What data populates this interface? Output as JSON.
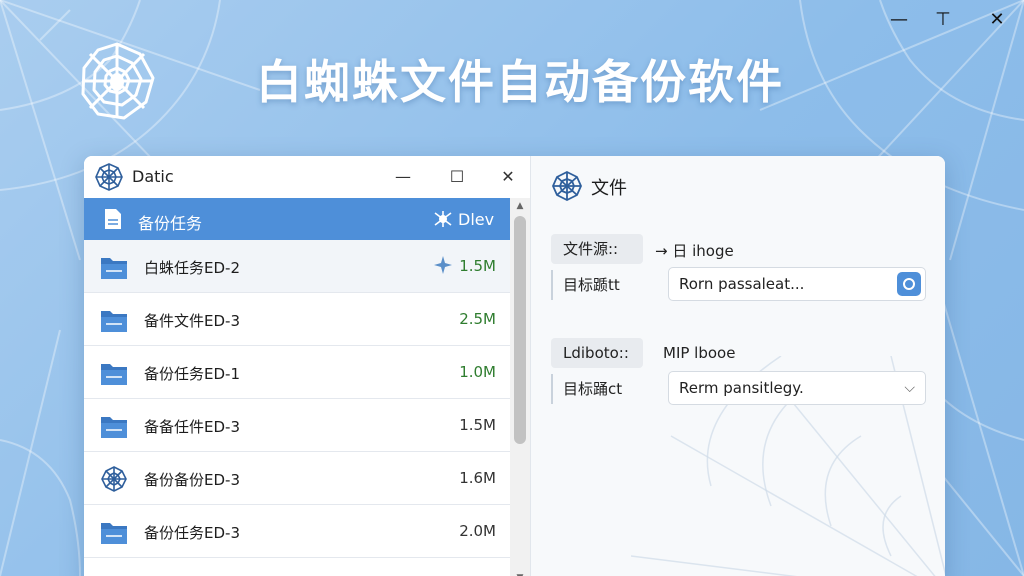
{
  "app": {
    "title": "白蜘蛛文件自动备份软件"
  },
  "outer_controls": {
    "minimize": "—",
    "maximize": "⊤",
    "close": "✕"
  },
  "window": {
    "title": "Datic",
    "controls": {
      "minimize": "—",
      "maximize": "☐",
      "close": "✕"
    }
  },
  "list": {
    "header": {
      "label": "备份任务",
      "right_label": "Dlev"
    },
    "rows": [
      {
        "name": "白蛛任务ED-2",
        "size": "1.5M",
        "icon": "folder-icon",
        "size_color": "#2f7d2f"
      },
      {
        "name": "备件文件ED-3",
        "size": "2.5M",
        "icon": "folder-icon",
        "size_color": "#2f7d2f"
      },
      {
        "name": "备份任务ED-1",
        "size": "1.0M",
        "icon": "folder-icon",
        "size_color": "#2f7d2f"
      },
      {
        "name": "备备任件ED-3",
        "size": "1.5M",
        "icon": "folder-icon",
        "size_color": "#333333"
      },
      {
        "name": "备份备份ED-3",
        "size": "1.6M",
        "icon": "spider-web-icon",
        "size_color": "#333333"
      },
      {
        "name": "备份任务ED-3",
        "size": "2.0M",
        "icon": "folder-icon",
        "size_color": "#333333"
      }
    ]
  },
  "detail": {
    "title": "文件",
    "group1": {
      "source_label": "文件源::",
      "source_value": "→ 日 ihoge",
      "target_label": "目标踬tt",
      "target_value": "Rorn passaleat..."
    },
    "group2": {
      "source_label": "Ldiboto::",
      "source_value": "MIP lbooe",
      "target_label": "目标踊ct",
      "target_value": "Rerm pansitlegy."
    }
  },
  "colors": {
    "accent": "#4e8fd9",
    "green": "#2f7d2f",
    "background": "#98c4ec"
  }
}
